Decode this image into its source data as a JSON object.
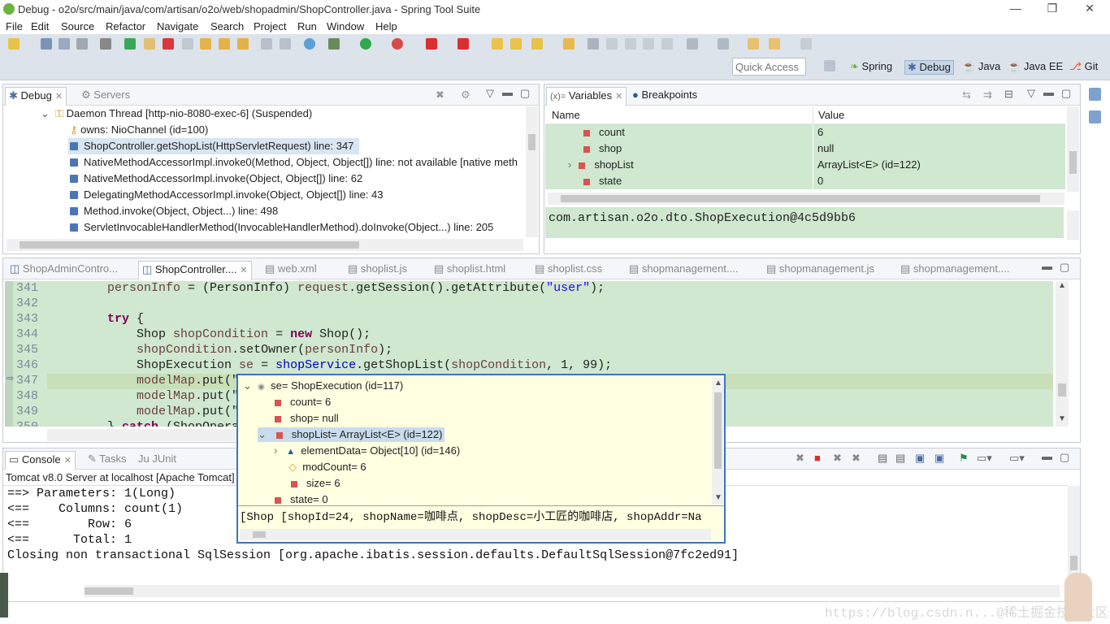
{
  "window": {
    "title": "Debug - o2o/src/main/java/com/artisan/o2o/web/shopadmin/ShopController.java - Spring Tool Suite",
    "controls": [
      "—",
      "❐",
      "✕"
    ]
  },
  "menu": [
    "File",
    "Edit",
    "Source",
    "Refactor",
    "Navigate",
    "Search",
    "Project",
    "Run",
    "Window",
    "Help"
  ],
  "toolbar": {
    "quick_access_placeholder": "Quick Access",
    "perspectives": [
      "Spring",
      "Debug",
      "Java",
      "Java EE",
      "Git"
    ],
    "active_perspective": "Debug"
  },
  "debug_view": {
    "tabs": [
      "Debug",
      "Servers"
    ],
    "thread": "Daemon Thread [http-nio-8080-exec-6] (Suspended)",
    "owns": "owns: NioChannel  (id=100)",
    "frames": [
      "ShopController.getShopList(HttpServletRequest) line: 347",
      "NativeMethodAccessorImpl.invoke0(Method, Object, Object[]) line: not available [native meth",
      "NativeMethodAccessorImpl.invoke(Object, Object[]) line: 62",
      "DelegatingMethodAccessorImpl.invoke(Object, Object[]) line: 43",
      "Method.invoke(Object, Object...) line: 498",
      "ServletInvocableHandlerMethod(InvocableHandlerMethod).doInvoke(Object...) line: 205"
    ]
  },
  "variables_view": {
    "tabs": [
      "Variables",
      "Breakpoints"
    ],
    "tab_prefix": "(x)=",
    "col_name": "Name",
    "col_value": "Value",
    "rows": [
      {
        "name": "count",
        "value": "6"
      },
      {
        "name": "shop",
        "value": "null"
      },
      {
        "name": "shopList",
        "value": "ArrayList<E>  (id=122)"
      },
      {
        "name": "state",
        "value": "0"
      }
    ],
    "detail": "com.artisan.o2o.dto.ShopExecution@4c5d9bb6"
  },
  "editor": {
    "tabs": [
      "ShopAdminContro...",
      "ShopController....",
      "web.xml",
      "shoplist.js",
      "shoplist.html",
      "shoplist.css",
      "shopmanagement....",
      "shopmanagement.js",
      "shopmanagement...."
    ],
    "active_tab": 1,
    "line_numbers": [
      "341",
      "342",
      "343",
      "344",
      "345",
      "346",
      "347",
      "348",
      "349",
      "350"
    ]
  },
  "popup": {
    "root": "se= ShopExecution  (id=117)",
    "count": "count= 6",
    "shop": "shop= null",
    "shopList": "shopList= ArrayList<E>  (id=122)",
    "elementData": "elementData= Object[10]  (id=146)",
    "modCount": "modCount= 6",
    "size": "size= 6",
    "state": "state= 0",
    "detail": "[Shop [shopId=24, shopName=咖啡点, shopDesc=小工匠的咖啡店, shopAddr=Na"
  },
  "console": {
    "tabs": [
      "Console",
      "Tasks",
      "JUnit"
    ],
    "junit_prefix": "Ju",
    "title": "Tomcat v8.0 Server at localhost [Apache Tomcat]",
    "lines": [
      "==> Parameters: 1(Long)",
      "<==    Columns: count(1)",
      "<==        Row: 6",
      "<==      Total: 1",
      "Closing non transactional SqlSession [org.apache.ibatis.session.defaults.DefaultSqlSession@7fc2ed91]"
    ]
  },
  "watermark": "https://blog.csdn.n...@稀土掘金技术社区"
}
